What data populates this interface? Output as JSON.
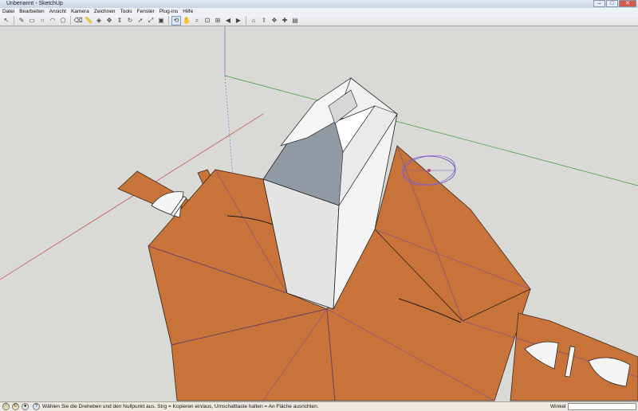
{
  "window": {
    "title": "Unbenannt - SketchUp"
  },
  "menu": [
    "Datei",
    "Bearbeiten",
    "Ansicht",
    "Kamera",
    "Zeichnen",
    "Tools",
    "Fenster",
    "Plug-ins",
    "Hilfe"
  ],
  "toolbar": {
    "tools": [
      {
        "name": "select-tool-icon",
        "active": false
      },
      {
        "name": "pencil-tool-icon",
        "active": false
      },
      {
        "name": "rectangle-tool-icon",
        "active": false
      },
      {
        "name": "circle-tool-icon",
        "active": false
      },
      {
        "name": "arc-tool-icon",
        "active": false
      },
      {
        "name": "shape-tool-icon",
        "active": false
      },
      {
        "name": "eraser-tool-icon",
        "active": false
      },
      {
        "name": "tape-measure-tool-icon",
        "active": false
      },
      {
        "name": "paint-bucket-tool-icon",
        "active": false
      },
      {
        "name": "move-tool-icon",
        "active": false
      },
      {
        "name": "push-pull-tool-icon",
        "active": false
      },
      {
        "name": "rotate-tool-icon",
        "active": false
      },
      {
        "name": "follow-me-tool-icon",
        "active": false
      },
      {
        "name": "scale-tool-icon",
        "active": false
      },
      {
        "name": "offset-tool-icon",
        "active": false
      },
      {
        "name": "orbit-tool-icon",
        "active": true
      },
      {
        "name": "pan-tool-icon",
        "active": false
      },
      {
        "name": "zoom-tool-icon",
        "active": false
      },
      {
        "name": "zoom-window-tool-icon",
        "active": false
      },
      {
        "name": "zoom-extents-tool-icon",
        "active": false
      },
      {
        "name": "previous-view-icon",
        "active": false
      },
      {
        "name": "next-view-icon",
        "active": false
      },
      {
        "name": "warehouse-icon",
        "active": false
      },
      {
        "name": "share-model-icon",
        "active": false
      },
      {
        "name": "components-icon",
        "active": false
      },
      {
        "name": "extension-warehouse-icon",
        "active": false
      },
      {
        "name": "layout-icon",
        "active": false
      }
    ]
  },
  "statusbar": {
    "message": "Wählen Sie die Dreheben und den Nullpunkt aus.  Strg = Kopieren ein/aus, Umschalttaste halten = An Fläche ausrichten.",
    "vcb_label": "Winkel",
    "vcb_value": ""
  },
  "colors": {
    "sky": "#d9d9d5",
    "back_face": "#c8733a",
    "box_front": "#e6e6e6",
    "box_side": "#f5f5f5",
    "box_top": "#8f9aa5",
    "axis_red": "#c44040",
    "axis_green": "#3a9a3a",
    "axis_blue": "#6a6ac8",
    "protractor": "#7c5cc8"
  }
}
